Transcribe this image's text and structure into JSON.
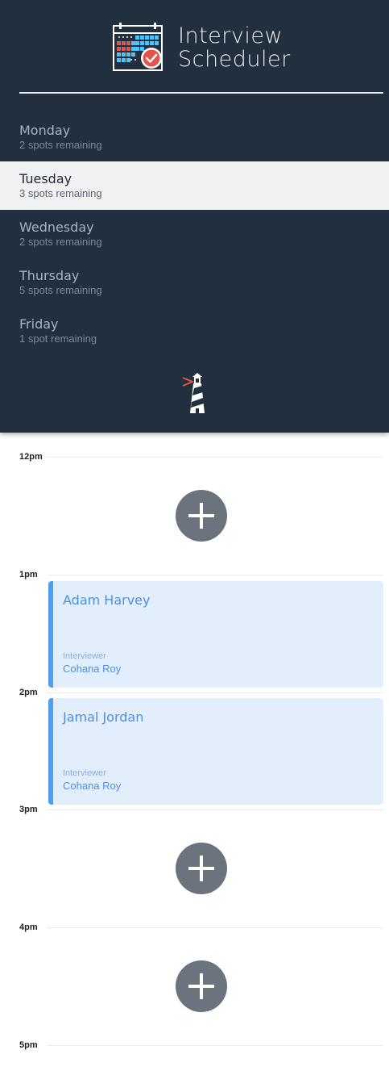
{
  "app": {
    "title_line1": "Interview",
    "title_line2": "Scheduler",
    "logo_icon": "calendar-check-icon",
    "footer_icon": "lighthouse-icon"
  },
  "days": [
    {
      "name": "Monday",
      "spots": "2 spots remaining",
      "selected": false
    },
    {
      "name": "Tuesday",
      "spots": "3 spots remaining",
      "selected": true
    },
    {
      "name": "Wednesday",
      "spots": "2 spots remaining",
      "selected": false
    },
    {
      "name": "Thursday",
      "spots": "5 spots remaining",
      "selected": false
    },
    {
      "name": "Friday",
      "spots": "1 spot remaining",
      "selected": false
    }
  ],
  "schedule": {
    "hours": [
      "12pm",
      "1pm",
      "2pm",
      "3pm",
      "4pm",
      "5pm"
    ],
    "add_icon": "plus-icon",
    "appointments": [
      {
        "student": "Adam Harvey",
        "interviewer_label": "Interviewer",
        "interviewer": "Cohana Roy"
      },
      {
        "student": "Jamal Jordan",
        "interviewer_label": "Interviewer",
        "interviewer": "Cohana Roy"
      }
    ]
  },
  "colors": {
    "sidebar_bg": "#222f3e",
    "selected_bg": "#f1f1f1",
    "appointment_bg": "#e2eefc",
    "appointment_accent": "#4f9ff0",
    "add_button": "#6b737c"
  }
}
